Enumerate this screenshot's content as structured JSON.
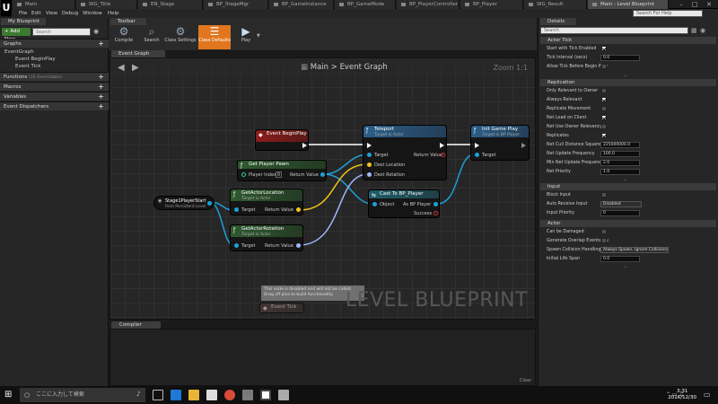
{
  "tabs": [
    {
      "label": "Main",
      "active": false
    },
    {
      "label": "WG_Title",
      "active": false
    },
    {
      "label": "EN_Stage",
      "active": false
    },
    {
      "label": "BP_StageMgr",
      "active": false
    },
    {
      "label": "BP_GameInstance",
      "active": false
    },
    {
      "label": "BP_GameMode",
      "active": false
    },
    {
      "label": "BP_PlayerController",
      "active": false
    },
    {
      "label": "BP_Player",
      "active": false
    },
    {
      "label": "WG_Result",
      "active": false
    },
    {
      "label": "Main - Level Blueprint",
      "active": true
    }
  ],
  "menu": [
    "File",
    "Edit",
    "View",
    "Debug",
    "Window",
    "Help"
  ],
  "search_help_placeholder": "Search For Help",
  "left_panel": {
    "tab": "My Blueprint",
    "add_new": "+ Add New",
    "search_placeholder": "Search",
    "graphs_header": "Graphs",
    "event_graph": "EventGraph",
    "events": [
      "Event BeginPlay",
      "Event Tick"
    ],
    "functions_header": "Functions",
    "functions_note": "(16 Overridable)",
    "macros_header": "Macros",
    "variables_header": "Variables",
    "dispatchers_header": "Event Dispatchers"
  },
  "toolbar": {
    "tab": "Toolbar",
    "buttons": [
      {
        "label": "Compile",
        "icon": "compile-icon"
      },
      {
        "label": "Search",
        "icon": "binoculars-icon"
      },
      {
        "label": "Class Settings",
        "icon": "gears-icon"
      },
      {
        "label": "Class Defaults",
        "icon": "defaults-icon"
      },
      {
        "label": "Play",
        "icon": "play-icon"
      }
    ]
  },
  "graph": {
    "tab": "Event Graph",
    "crumb_main": "Main",
    "crumb_sep": ">",
    "crumb_graph": "Event Graph",
    "zoom": "Zoom 1:1",
    "watermark": "LEVEL BLUEPRINT",
    "nodes": {
      "begin_play": {
        "title": "Event BeginPlay"
      },
      "teleport": {
        "title": "Teleport",
        "sub": "Target is Actor",
        "pins_in": [
          "Target",
          "Dest Location",
          "Dest Rotation"
        ],
        "pin_out": "Return Value"
      },
      "init_game": {
        "title": "Init Game Play",
        "sub": "Target is BP Player",
        "pins_in": [
          "Target"
        ]
      },
      "get_player_pawn": {
        "title": "Get Player Pawn",
        "pin_in": "Player Index",
        "index_value": "0",
        "pin_out": "Return Value"
      },
      "player_start": {
        "title": "Stage1PlayerStart",
        "sub": "from Persistent Level"
      },
      "cast": {
        "title": "Cast To BP_Player",
        "pin_in": "Object",
        "pins_out": [
          "As BP Player",
          "Success"
        ]
      },
      "get_location": {
        "title": "GetActorLocation",
        "sub": "Target is Actor",
        "pin_in": "Target",
        "pin_out": "Return Value"
      },
      "get_rotation": {
        "title": "GetActorRotation",
        "sub": "Target is Actor",
        "pin_in": "Target",
        "pin_out": "Return Value"
      },
      "event_tick": {
        "title": "Event Tick"
      }
    },
    "disabled_note": "This node is disabled and will not be called. Drag off pins to build functionality."
  },
  "compile": {
    "tab": "Compiler Results",
    "clear": "Clear"
  },
  "details": {
    "tab": "Details",
    "search_placeholder": "Search",
    "actor_tick": {
      "header": "Actor Tick",
      "start_with_tick": {
        "label": "Start with Tick Enabled",
        "checked": true
      },
      "tick_interval": {
        "label": "Tick Interval (secs)",
        "value": "0.0"
      },
      "allow_tick_pause": {
        "label": "Allow Tick Before Begin Play",
        "checked": false
      }
    },
    "replication": {
      "header": "Replication",
      "items": [
        {
          "label": "Only Relevant to Owner",
          "checked": false
        },
        {
          "label": "Always Relevant",
          "checked": true
        },
        {
          "label": "Replicate Movement",
          "checked": false
        },
        {
          "label": "Net Load on Client",
          "checked": true
        },
        {
          "label": "Net Use Owner Relevancy",
          "checked": false
        },
        {
          "label": "Replicates",
          "checked": true
        }
      ],
      "fields": [
        {
          "label": "Net Cull Distance Squared",
          "value": "225000000.0"
        },
        {
          "label": "Net Update Frequency",
          "value": "100.0"
        },
        {
          "label": "Min Net Update Frequency",
          "value": "2.0"
        },
        {
          "label": "Net Priority",
          "value": "1.0"
        }
      ]
    },
    "input": {
      "header": "Input",
      "block_input": {
        "label": "Block Input",
        "checked": false
      },
      "auto_receive": {
        "label": "Auto Receive Input",
        "value": "Disabled"
      },
      "input_priority": {
        "label": "Input Priority",
        "value": "0"
      }
    },
    "actor": {
      "header": "Actor",
      "can_be_damaged": {
        "label": "Can be Damaged",
        "checked": false
      },
      "overlap_events": {
        "label": "Generate Overlap Events Du",
        "checked": false
      },
      "spawn_handling": {
        "label": "Spawn Collision Handling Me",
        "value": "Always Spawn, Ignore Collisions"
      },
      "life_span": {
        "label": "Initial Life Span",
        "value": "0.0"
      }
    }
  },
  "taskbar": {
    "search_placeholder": "ここに入力して検索",
    "time": "3:31",
    "date": "2016/12/30"
  },
  "colors": {
    "accent": "#e1761e",
    "exec": "#ffffff",
    "object_pin": "#1ea0d8",
    "vector_pin": "#f0c419",
    "rotator_pin": "#9fb7ff",
    "event_header": "#8c1c1c"
  }
}
